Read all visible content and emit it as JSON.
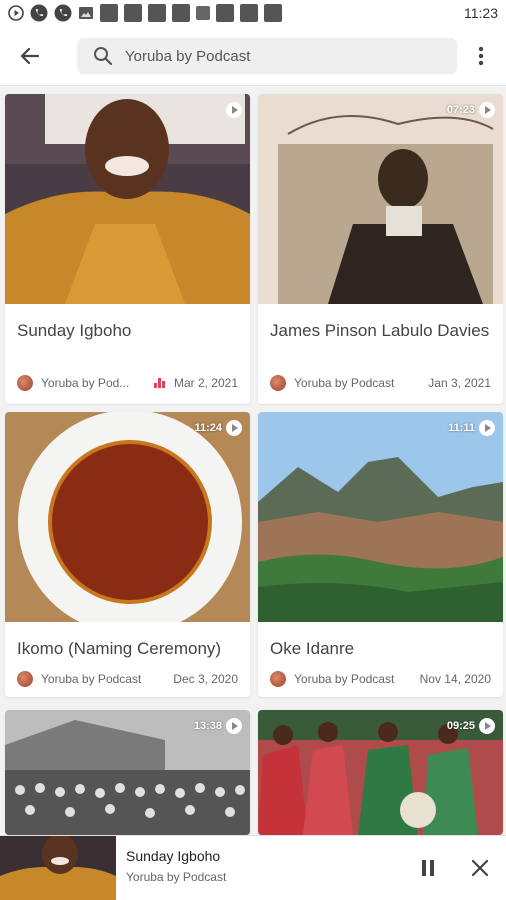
{
  "status_bar": {
    "time": "11:23",
    "icons": [
      "play-icon",
      "phone-icon",
      "phone-icon",
      "image-icon",
      "notification-icon",
      "notification-icon",
      "notification-icon",
      "notification-icon",
      "a-icon",
      "notification-icon",
      "notification-icon",
      "notification-icon"
    ]
  },
  "header": {
    "search_text": "Yoruba by Podcast",
    "back_icon": "back-arrow-icon",
    "menu_icon": "more-vert-icon"
  },
  "cards": [
    {
      "title": "Sunday Igboho",
      "duration": "",
      "author": "Yoruba by Pod...",
      "date": "Mar 2, 2021",
      "trending": true
    },
    {
      "title": "James Pinson Labulo Davies",
      "duration": "07:23",
      "author": "Yoruba by Podcast",
      "date": "Jan 3, 2021",
      "trending": false
    },
    {
      "title": "Ikomo (Naming Ceremony)",
      "duration": "11:24",
      "author": "Yoruba by Podcast",
      "date": "Dec 3, 2020",
      "trending": false
    },
    {
      "title": "Oke Idanre",
      "duration": "11:11",
      "author": "Yoruba by Podcast",
      "date": "Nov 14, 2020",
      "trending": false
    },
    {
      "title": "",
      "duration": "13:38",
      "author": "",
      "date": "",
      "trending": false
    },
    {
      "title": "",
      "duration": "09:25",
      "author": "",
      "date": "",
      "trending": false
    }
  ],
  "mini_player": {
    "title": "Sunday Igboho",
    "subtitle": "Yoruba by Podcast",
    "pause_icon": "pause-icon",
    "close_icon": "close-icon"
  },
  "colors": {
    "accent_trending": "#e0435a",
    "background": "#f2f2f2",
    "card": "#ffffff"
  }
}
